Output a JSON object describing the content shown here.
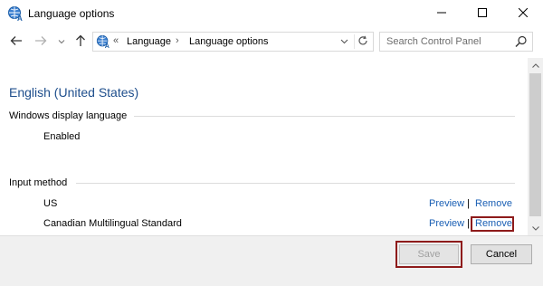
{
  "window": {
    "title": "Language options",
    "icons": {
      "app": "language-globe-icon",
      "minimize": "minimize-icon",
      "maximize": "maximize-icon",
      "close": "close-icon"
    }
  },
  "nav": {
    "icons": {
      "back": "back-arrow-icon",
      "forward": "forward-arrow-icon",
      "recent": "chevron-down-icon",
      "up": "up-arrow-icon"
    },
    "address": {
      "prefix": "«",
      "crumbs": [
        "Language",
        "Language options"
      ],
      "separator": "›",
      "icons": {
        "location": "language-globe-icon",
        "dropdown": "chevron-down-icon",
        "refresh": "refresh-icon"
      }
    },
    "search": {
      "placeholder": "Search Control Panel",
      "icon": "search-icon"
    }
  },
  "content": {
    "language_title": "English (United States)",
    "display_language": {
      "label": "Windows display language",
      "status": "Enabled"
    },
    "input_method": {
      "label": "Input method",
      "items": [
        {
          "name": "US",
          "preview": "Preview",
          "separator": "|",
          "remove": "Remove"
        },
        {
          "name": "Canadian Multilingual Standard",
          "preview": "Preview",
          "separator": "|",
          "remove": "Remove"
        }
      ]
    }
  },
  "scrollbar": {
    "icons": {
      "up": "scroll-up-icon",
      "down": "scroll-down-icon"
    }
  },
  "footer": {
    "save_label": "Save",
    "cancel_label": "Cancel"
  },
  "colors": {
    "heading": "#1e4e8c",
    "link": "#1a5fb4",
    "focus_highlight": "#8e1b1b"
  }
}
